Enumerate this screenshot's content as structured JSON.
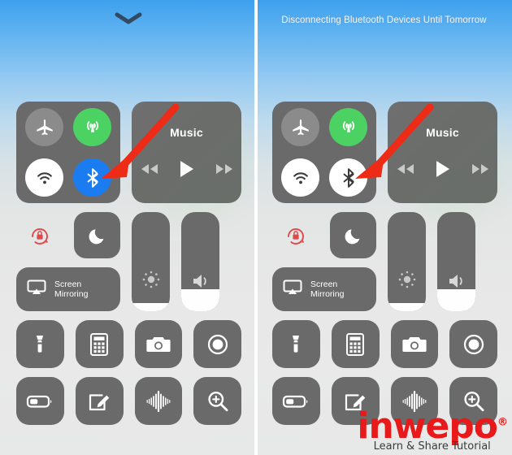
{
  "meta": {
    "colors": {
      "tile_gray": "#6a6a6a",
      "toggle_off_gray": "#8b8b8b",
      "cellular_green": "#4cd263",
      "bluetooth_blue": "#1a7cf0",
      "white": "#ffffff",
      "rotation_lock_red": "#e0484a",
      "arrow_red": "#ee2b17",
      "watermark_red": "#e8191a",
      "banner_text": "#f2f6fb",
      "sky_top": "#3ea0ee",
      "sky_bottom": "#e8e9e9"
    }
  },
  "panels": [
    {
      "id": "before",
      "banner": "",
      "handle_icon": "chevron-down-icon",
      "connectivity": {
        "airplane": {
          "label": "Airplane Mode",
          "icon": "airplane-icon",
          "state": "off",
          "style": "off"
        },
        "cellular": {
          "label": "Cellular Data",
          "icon": "cellular-antenna-icon",
          "state": "on",
          "style": "green"
        },
        "wifi": {
          "label": "Wi-Fi",
          "icon": "wifi-icon",
          "state": "on",
          "style": "white"
        },
        "bluetooth": {
          "label": "Bluetooth",
          "icon": "bluetooth-icon",
          "state": "on",
          "style": "blue"
        }
      },
      "music": {
        "title": "Music",
        "rewind_icon": "rewind-icon",
        "play_icon": "play-icon",
        "forward_icon": "fast-forward-icon"
      },
      "rotation_lock": {
        "label": "Portrait Orientation Lock",
        "icon": "rotation-lock-icon",
        "state": "on"
      },
      "do_not_disturb": {
        "label": "Do Not Disturb",
        "icon": "moon-icon",
        "state": "off"
      },
      "screen_mirroring": {
        "label_line1": "Screen",
        "label_line2": "Mirroring",
        "icon": "airplay-screen-icon"
      },
      "brightness": {
        "label": "Brightness",
        "icon": "brightness-icon",
        "value_percent": 8
      },
      "volume": {
        "label": "Volume",
        "icon": "speaker-icon",
        "value_percent": 22
      },
      "shortcuts": [
        {
          "label": "Flashlight",
          "icon": "flashlight-icon"
        },
        {
          "label": "Calculator",
          "icon": "calculator-icon"
        },
        {
          "label": "Camera",
          "icon": "camera-icon"
        },
        {
          "label": "Screen Recording",
          "icon": "screen-record-icon"
        },
        {
          "label": "Low Power Mode",
          "icon": "battery-low-power-icon"
        },
        {
          "label": "Notes",
          "icon": "notes-pencil-icon"
        },
        {
          "label": "Voice Memos",
          "icon": "voice-memo-waveform-icon"
        },
        {
          "label": "Magnifier",
          "icon": "magnifier-plus-icon"
        }
      ],
      "annotation_arrow": {
        "icon": "red-arrow-icon",
        "points_at": "bluetooth-toggle"
      }
    },
    {
      "id": "after",
      "banner": "Disconnecting Bluetooth Devices Until Tomorrow",
      "handle_icon": "",
      "connectivity": {
        "airplane": {
          "label": "Airplane Mode",
          "icon": "airplane-icon",
          "state": "off",
          "style": "off"
        },
        "cellular": {
          "label": "Cellular Data",
          "icon": "cellular-antenna-icon",
          "state": "on",
          "style": "green"
        },
        "wifi": {
          "label": "Wi-Fi",
          "icon": "wifi-icon",
          "state": "on",
          "style": "white"
        },
        "bluetooth": {
          "label": "Bluetooth",
          "icon": "bluetooth-icon",
          "state": "disconnected",
          "style": "white"
        }
      },
      "music": {
        "title": "Music",
        "rewind_icon": "rewind-icon",
        "play_icon": "play-icon",
        "forward_icon": "fast-forward-icon"
      },
      "rotation_lock": {
        "label": "Portrait Orientation Lock",
        "icon": "rotation-lock-icon",
        "state": "on"
      },
      "do_not_disturb": {
        "label": "Do Not Disturb",
        "icon": "moon-icon",
        "state": "off"
      },
      "screen_mirroring": {
        "label_line1": "Screen",
        "label_line2": "Mirroring",
        "icon": "airplay-screen-icon"
      },
      "brightness": {
        "label": "Brightness",
        "icon": "brightness-icon",
        "value_percent": 8
      },
      "volume": {
        "label": "Volume",
        "icon": "speaker-icon",
        "value_percent": 22
      },
      "shortcuts": [
        {
          "label": "Flashlight",
          "icon": "flashlight-icon"
        },
        {
          "label": "Calculator",
          "icon": "calculator-icon"
        },
        {
          "label": "Camera",
          "icon": "camera-icon"
        },
        {
          "label": "Screen Recording",
          "icon": "screen-record-icon"
        },
        {
          "label": "Low Power Mode",
          "icon": "battery-low-power-icon"
        },
        {
          "label": "Notes",
          "icon": "notes-pencil-icon"
        },
        {
          "label": "Voice Memos",
          "icon": "voice-memo-waveform-icon"
        },
        {
          "label": "Magnifier",
          "icon": "magnifier-plus-icon"
        }
      ],
      "annotation_arrow": {
        "icon": "red-arrow-icon",
        "points_at": "bluetooth-toggle"
      }
    }
  ],
  "watermark": {
    "brand": "inwepo",
    "registered_mark": "®",
    "tagline": "Learn & Share Tutorial"
  }
}
